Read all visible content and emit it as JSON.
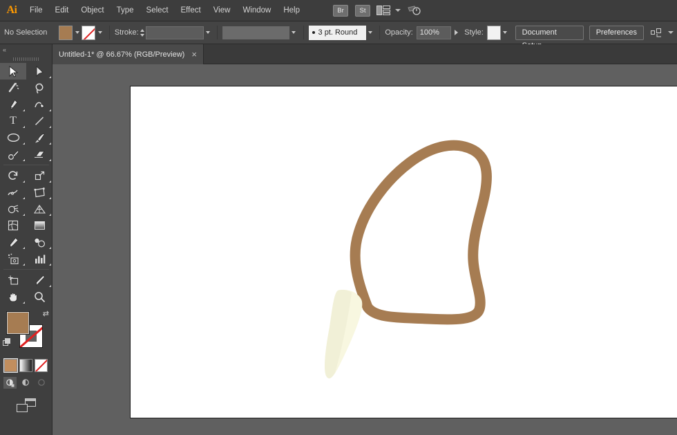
{
  "app": {
    "name": "Adobe Illustrator",
    "logo_text": "Ai"
  },
  "menubar": {
    "items": [
      {
        "label": "File"
      },
      {
        "label": "Edit"
      },
      {
        "label": "Object"
      },
      {
        "label": "Type"
      },
      {
        "label": "Select"
      },
      {
        "label": "Effect"
      },
      {
        "label": "View"
      },
      {
        "label": "Window"
      },
      {
        "label": "Help"
      }
    ],
    "bridge_label": "Br",
    "stock_label": "St",
    "arrange_icon": "arrange-documents-icon",
    "workspace_icon": "workspace-switcher-icon"
  },
  "controlbar": {
    "selection_status": "No Selection",
    "fill_label": "fill-swatch",
    "fill_color": "#a67c52",
    "stroke_swatch_label": "stroke-swatch-none",
    "stroke_label": "Stroke:",
    "stroke_weight_value": "",
    "variable_width_value": "",
    "brush_definition": "3 pt. Round",
    "opacity_label": "Opacity:",
    "opacity_value": "100%",
    "style_label": "Style:",
    "document_setup_label": "Document Setup",
    "preferences_label": "Preferences",
    "align_icon": "align-to-selection-icon"
  },
  "tabbar": {
    "collapse_icon": "«",
    "tab_title": "Untitled-1* @ 66.67% (RGB/Preview)",
    "close_icon": "×"
  },
  "toolbar": {
    "collapse_icon": "«",
    "tools": [
      {
        "name": "selection-tool",
        "glyph": "➤",
        "active": true,
        "corner": false
      },
      {
        "name": "direct-selection-tool",
        "glyph": "➤",
        "active": false,
        "corner": true
      },
      {
        "name": "magic-wand-tool",
        "glyph": "✦",
        "active": false,
        "corner": false
      },
      {
        "name": "lasso-tool",
        "glyph": "Ↄ",
        "active": false,
        "corner": false
      },
      {
        "name": "pen-tool",
        "glyph": "✑",
        "active": false,
        "corner": true
      },
      {
        "name": "curvature-tool",
        "glyph": "✒",
        "active": false,
        "corner": true
      },
      {
        "name": "type-tool",
        "glyph": "T",
        "active": false,
        "corner": true
      },
      {
        "name": "line-segment-tool",
        "glyph": "╱",
        "active": false,
        "corner": true
      },
      {
        "name": "ellipse-tool",
        "glyph": "◯",
        "active": false,
        "corner": true
      },
      {
        "name": "paintbrush-tool",
        "glyph": "✒",
        "active": false,
        "corner": true
      },
      {
        "name": "shaper-pencil-tool",
        "glyph": "✎",
        "active": false,
        "corner": true
      },
      {
        "name": "eraser-tool",
        "glyph": "▱",
        "active": false,
        "corner": true
      },
      {
        "name": "rotate-tool",
        "glyph": "↺",
        "active": false,
        "corner": true
      },
      {
        "name": "scale-tool",
        "glyph": "⤡",
        "active": false,
        "corner": true
      },
      {
        "name": "width-warp-tool",
        "glyph": "∿",
        "active": false,
        "corner": true
      },
      {
        "name": "free-transform-tool",
        "glyph": "◱",
        "active": false,
        "corner": true
      },
      {
        "name": "shape-builder-tool",
        "glyph": "◔",
        "active": false,
        "corner": true
      },
      {
        "name": "perspective-grid-tool",
        "glyph": "◰",
        "active": false,
        "corner": true
      },
      {
        "name": "mesh-tool",
        "glyph": "⌗",
        "active": false,
        "corner": false
      },
      {
        "name": "gradient-tool",
        "glyph": "▤",
        "active": false,
        "corner": false
      },
      {
        "name": "eyedropper-tool",
        "glyph": "✐",
        "active": false,
        "corner": true
      },
      {
        "name": "blend-tool",
        "glyph": "◌",
        "active": false,
        "corner": true
      },
      {
        "name": "symbol-sprayer-tool",
        "glyph": "░",
        "active": false,
        "corner": true
      },
      {
        "name": "column-graph-tool",
        "glyph": "█",
        "active": false,
        "corner": true
      },
      {
        "name": "artboard-tool",
        "glyph": "⬚",
        "active": false,
        "corner": false
      },
      {
        "name": "slice-tool",
        "glyph": "✀",
        "active": false,
        "corner": true
      },
      {
        "name": "hand-tool",
        "glyph": "✋",
        "active": false,
        "corner": true
      },
      {
        "name": "zoom-tool",
        "glyph": "⚲",
        "active": false,
        "corner": false
      }
    ],
    "fill_color": "#a67c52",
    "stroke_color": "none",
    "swap_icon": "swap-fill-stroke-icon",
    "default_icon": "default-fill-stroke-icon",
    "color_modes": [
      {
        "name": "color-mode-button",
        "selected": true
      },
      {
        "name": "gradient-mode-button",
        "selected": false
      },
      {
        "name": "none-mode-button",
        "selected": false
      }
    ],
    "draw_modes": [
      {
        "name": "draw-normal-button",
        "glyph": "◑",
        "state": "active"
      },
      {
        "name": "draw-behind-button",
        "glyph": "◐",
        "state": "normal"
      },
      {
        "name": "draw-inside-button",
        "glyph": "○",
        "state": "dim"
      }
    ],
    "screen_mode_icon": "change-screen-mode-icon"
  },
  "canvas": {
    "background_color": "#606060",
    "artboard_color": "#ffffff",
    "zoom_level": "66.67%",
    "artwork": {
      "name": "brown-loop-with-cream-shape",
      "loop_color": "#a67c52",
      "cream_color": "#f8f7e0",
      "cream_shade_color": "#eeedd2"
    },
    "faint_bottom_mark": ""
  }
}
